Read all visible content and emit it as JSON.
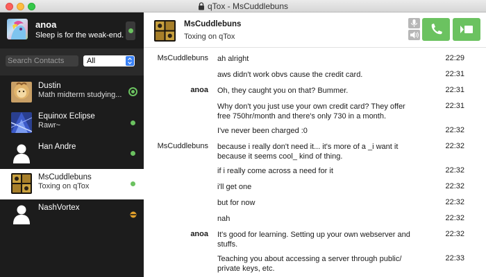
{
  "window": {
    "title": "qTox - MsCuddlebuns"
  },
  "self": {
    "name": "anoa",
    "status_message": "Sleep is for the weak-end."
  },
  "search": {
    "placeholder": "Search Contacts",
    "filter_value": "All"
  },
  "contacts": [
    {
      "name": "Dustin",
      "status": "Math midterm studying...",
      "presence": "online-ring"
    },
    {
      "name": "Equinox Eclipse",
      "status": "Rawr~",
      "presence": "online"
    },
    {
      "name": "Han Andre",
      "status": "",
      "presence": "online"
    },
    {
      "name": "MsCuddlebuns",
      "status": "Toxing on qTox",
      "presence": "online",
      "selected": true
    },
    {
      "name": "NashVortex",
      "status": "",
      "presence": "away"
    }
  ],
  "chat": {
    "name": "MsCuddlebuns",
    "status": "Toxing on qTox"
  },
  "messages": [
    {
      "author": "MsCuddlebuns",
      "text": "ah alright",
      "time": "22:29"
    },
    {
      "author": "",
      "text": "aws didn't work obvs cause the credit card.",
      "time": "22:31"
    },
    {
      "author": "anoa",
      "text": "Oh, they caught you on that? Bummer.",
      "time": "22:31"
    },
    {
      "author": "",
      "text": "Why don't you just use your own credit card? They offer free 750hr/month and there's only 730 in a month.",
      "time": "22:31"
    },
    {
      "author": "",
      "text": "I've never been charged :0",
      "time": "22:32"
    },
    {
      "author": "MsCuddlebuns",
      "text": "because i really don't need it... it's more of a _i want it because it seems cool_ kind of thing.",
      "time": "22:32"
    },
    {
      "author": "",
      "text": "if i really come across a need for it",
      "time": "22:32"
    },
    {
      "author": "",
      "text": "i'll get one",
      "time": "22:32"
    },
    {
      "author": "",
      "text": "but for now",
      "time": "22:32"
    },
    {
      "author": "",
      "text": "nah",
      "time": "22:32"
    },
    {
      "author": "anoa",
      "text": "It's good for learning. Setting up your own webserver and stuffs.",
      "time": "22:32"
    },
    {
      "author": "",
      "text": "Teaching you about accessing a server through public/ private keys, etc.",
      "time": "22:33"
    }
  ],
  "colors": {
    "accent_green": "#6bc260",
    "sidebar_bg": "#1c1c1c",
    "away_orange": "#e3a12b"
  }
}
